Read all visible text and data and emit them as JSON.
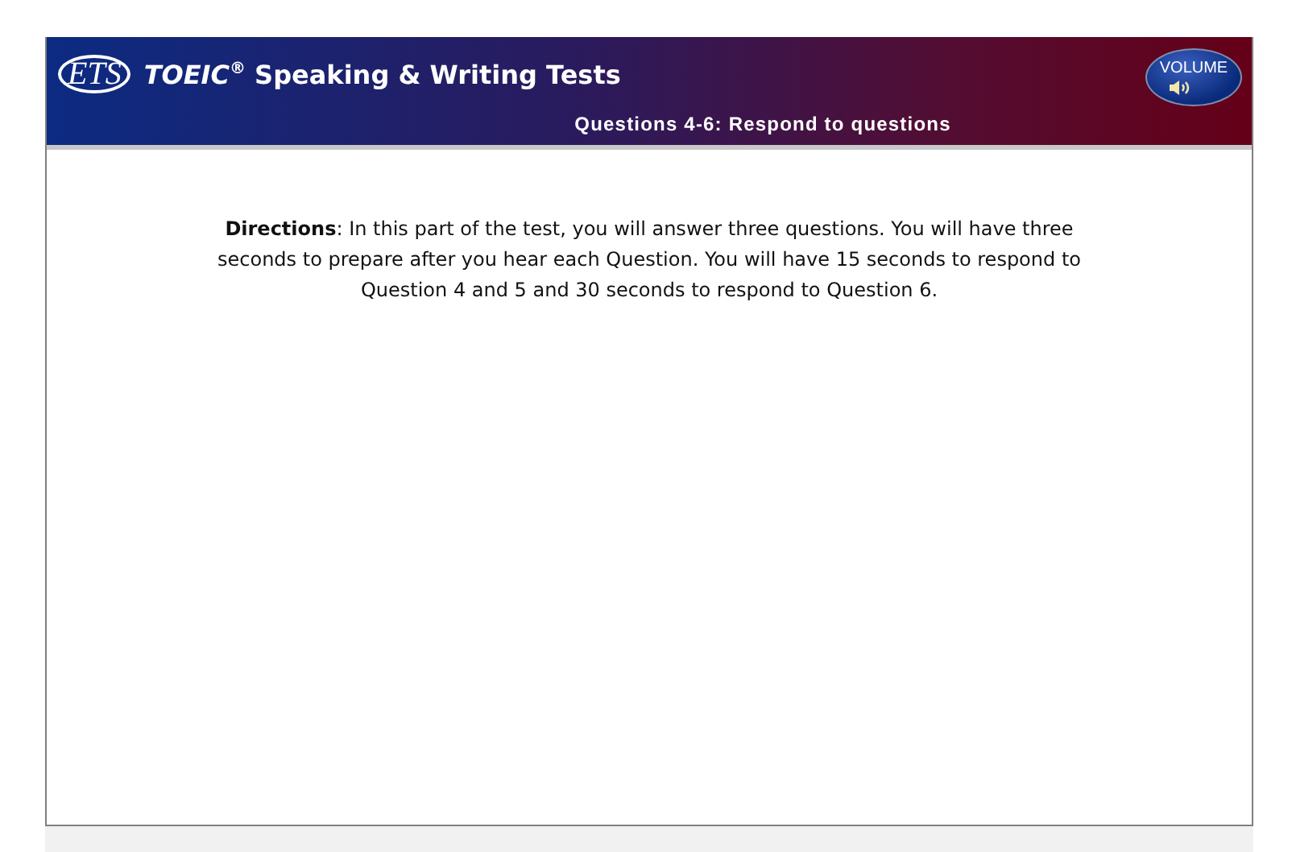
{
  "header": {
    "logo": "ETS",
    "title": "*TOEIC*$^{®}$ Speaking & Writing Tests",
    "subtitle": "Questions 4-6: Respond to questions",
    "volume_button": "VOLUME"
  },
  "directions": "**Directions**: In this part of the test, you will answer three questions. You will have three seconds to prepare after you hear each Question. You will have 15 seconds to respond to Question 4 and 5 and 30 seconds to respond to Question 6."
}
